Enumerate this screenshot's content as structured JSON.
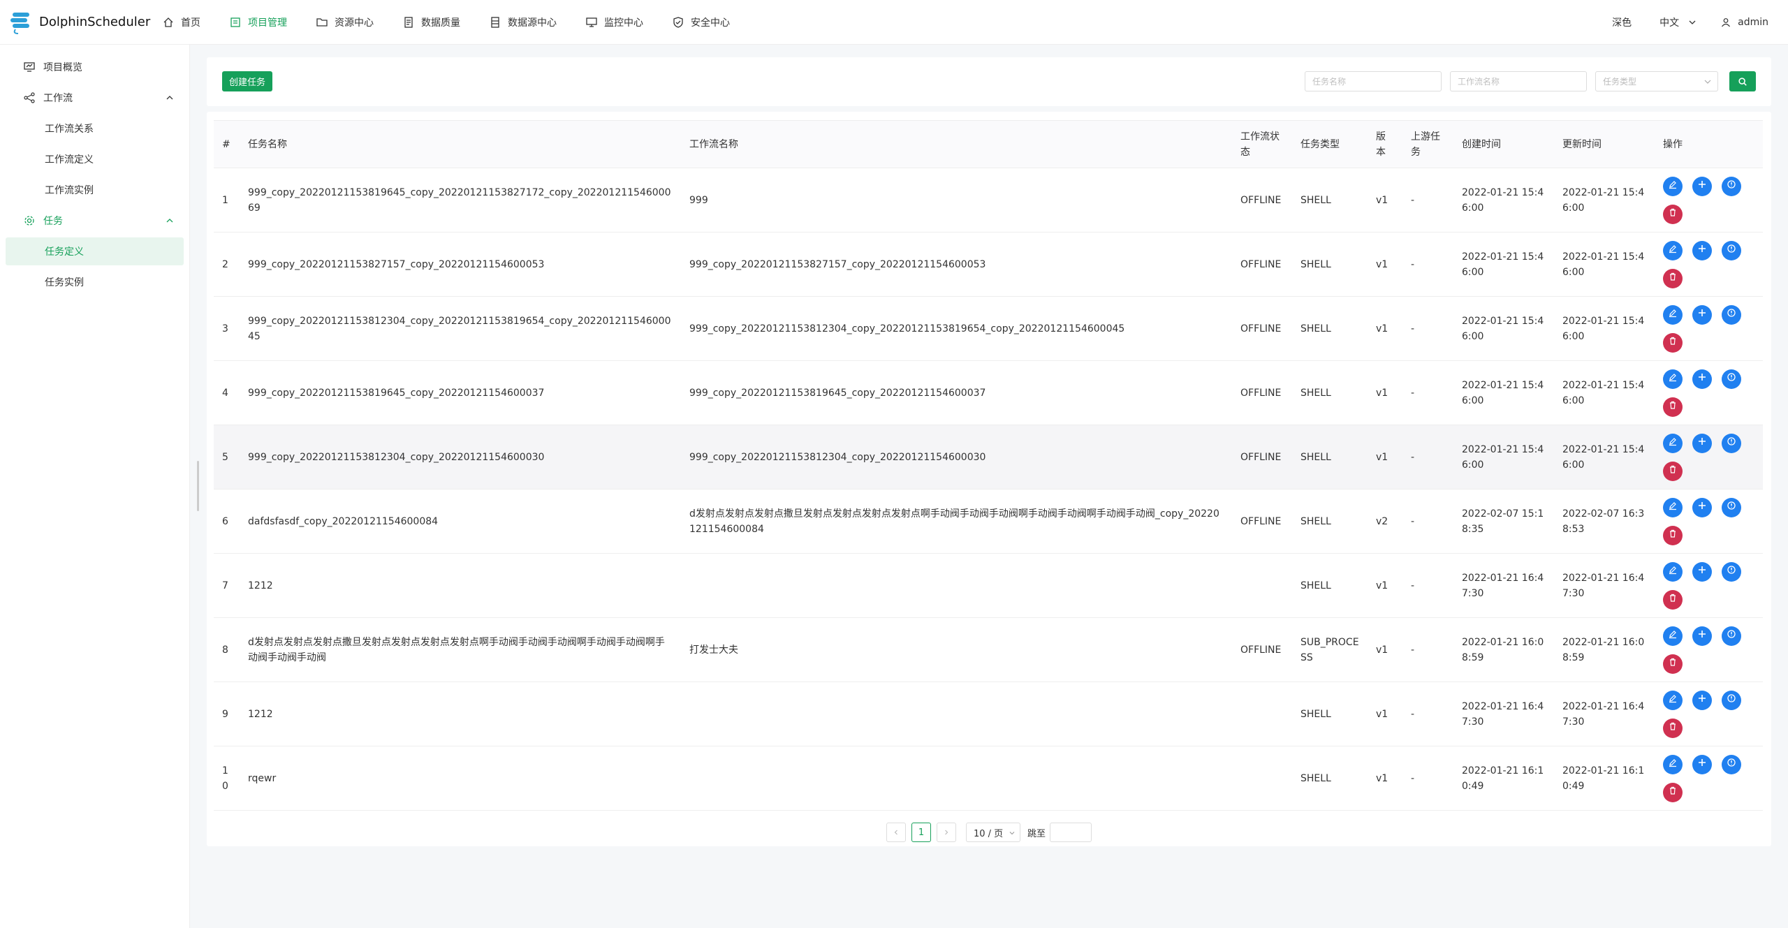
{
  "app": {
    "name": "DolphinScheduler"
  },
  "nav": [
    {
      "label": "首页",
      "icon": "home-icon",
      "active": false
    },
    {
      "label": "项目管理",
      "icon": "project-icon",
      "active": true
    },
    {
      "label": "资源中心",
      "icon": "folder-icon",
      "active": false
    },
    {
      "label": "数据质量",
      "icon": "data-quality-icon",
      "active": false
    },
    {
      "label": "数据源中心",
      "icon": "datasource-icon",
      "active": false
    },
    {
      "label": "监控中心",
      "icon": "monitor-icon",
      "active": false
    },
    {
      "label": "安全中心",
      "icon": "shield-icon",
      "active": false
    }
  ],
  "header_right": {
    "theme": "深色",
    "language": "中文",
    "user": "admin"
  },
  "sidebar": {
    "overview": "项目概览",
    "workflow": "工作流",
    "workflow_children": [
      "工作流关系",
      "工作流定义",
      "工作流实例"
    ],
    "task": "任务",
    "task_children": [
      "任务定义",
      "任务实例"
    ]
  },
  "toolbar": {
    "create_label": "创建任务",
    "task_name_placeholder": "任务名称",
    "workflow_name_placeholder": "工作流名称",
    "task_type_placeholder": "任务类型"
  },
  "table": {
    "headers": [
      "#",
      "任务名称",
      "工作流名称",
      "工作流状态",
      "任务类型",
      "版本",
      "上游任务",
      "创建时间",
      "更新时间",
      "操作"
    ],
    "rows": [
      {
        "idx": "1",
        "name": "999_copy_20220121153819645_copy_20220121153827172_copy_20220121154600069",
        "workflow": "999",
        "state": "OFFLINE",
        "type": "SHELL",
        "version": "v1",
        "upstream": "-",
        "created": "2022-01-21 15:46:00",
        "updated": "2022-01-21 15:46:00"
      },
      {
        "idx": "2",
        "name": "999_copy_20220121153827157_copy_20220121154600053",
        "workflow": "999_copy_20220121153827157_copy_20220121154600053",
        "state": "OFFLINE",
        "type": "SHELL",
        "version": "v1",
        "upstream": "-",
        "created": "2022-01-21 15:46:00",
        "updated": "2022-01-21 15:46:00"
      },
      {
        "idx": "3",
        "name": "999_copy_20220121153812304_copy_20220121153819654_copy_20220121154600045",
        "workflow": "999_copy_20220121153812304_copy_20220121153819654_copy_20220121154600045",
        "state": "OFFLINE",
        "type": "SHELL",
        "version": "v1",
        "upstream": "-",
        "created": "2022-01-21 15:46:00",
        "updated": "2022-01-21 15:46:00"
      },
      {
        "idx": "4",
        "name": "999_copy_20220121153819645_copy_20220121154600037",
        "workflow": "999_copy_20220121153819645_copy_20220121154600037",
        "state": "OFFLINE",
        "type": "SHELL",
        "version": "v1",
        "upstream": "-",
        "created": "2022-01-21 15:46:00",
        "updated": "2022-01-21 15:46:00"
      },
      {
        "idx": "5",
        "name": "999_copy_20220121153812304_copy_20220121154600030",
        "workflow": "999_copy_20220121153812304_copy_20220121154600030",
        "state": "OFFLINE",
        "type": "SHELL",
        "version": "v1",
        "upstream": "-",
        "created": "2022-01-21 15:46:00",
        "updated": "2022-01-21 15:46:00"
      },
      {
        "idx": "6",
        "name": "dafdsfasdf_copy_20220121154600084",
        "workflow": "d发射点发射点发射点撒旦发射点发射点发射点发射点啊手动阀手动阀手动阀啊手动阀手动阀啊手动阀手动阀_copy_20220121154600084",
        "state": "OFFLINE",
        "type": "SHELL",
        "version": "v2",
        "upstream": "-",
        "created": "2022-02-07 15:18:35",
        "updated": "2022-02-07 16:38:53"
      },
      {
        "idx": "7",
        "name": "1212",
        "workflow": "",
        "state": "",
        "type": "SHELL",
        "version": "v1",
        "upstream": "-",
        "created": "2022-01-21 16:47:30",
        "updated": "2022-01-21 16:47:30"
      },
      {
        "idx": "8",
        "name": "d发射点发射点发射点撒旦发射点发射点发射点发射点啊手动阀手动阀手动阀啊手动阀手动阀啊手动阀手动阀手动阀",
        "workflow": "打发士大夫",
        "state": "OFFLINE",
        "type": "SUB_PROCESS",
        "version": "v1",
        "upstream": "-",
        "created": "2022-01-21 16:08:59",
        "updated": "2022-01-21 16:08:59"
      },
      {
        "idx": "9",
        "name": "1212",
        "workflow": "",
        "state": "",
        "type": "SHELL",
        "version": "v1",
        "upstream": "-",
        "created": "2022-01-21 16:47:30",
        "updated": "2022-01-21 16:47:30"
      },
      {
        "idx": "10",
        "name": "rqewr",
        "workflow": "",
        "state": "",
        "type": "SHELL",
        "version": "v1",
        "upstream": "-",
        "created": "2022-01-21 16:10:49",
        "updated": "2022-01-21 16:10:49"
      }
    ]
  },
  "pagination": {
    "current": "1",
    "page_size": "10 / 页",
    "jump_label": "跳至"
  },
  "colors": {
    "primary": "#16a05a",
    "op_blue": "#2080f0",
    "op_red": "#d03050"
  }
}
